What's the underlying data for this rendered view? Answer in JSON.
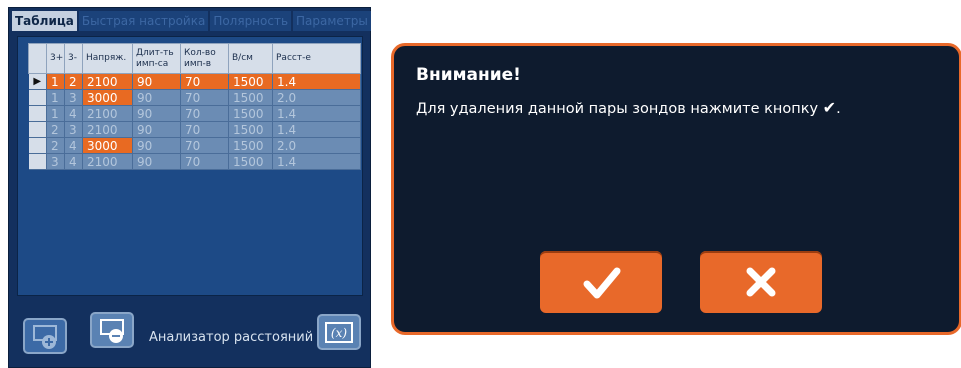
{
  "tabs": [
    {
      "label": "Таблица",
      "active": true
    },
    {
      "label": "Быстрая настройка",
      "active": false
    },
    {
      "label": "Полярность",
      "active": false
    },
    {
      "label": "Параметры",
      "active": false
    }
  ],
  "table": {
    "headers": [
      "",
      "3+",
      "3-",
      "Напряж.",
      "Длит-ть имп-са",
      "Кол-во имп-в",
      "В/см",
      "Расст-е"
    ],
    "rows": [
      {
        "marker": "▶",
        "cells": [
          "1",
          "2",
          "2100",
          "90",
          "70",
          "1500",
          "1.4"
        ],
        "active": true
      },
      {
        "marker": "",
        "cells": [
          "1",
          "3",
          "3000",
          "90",
          "70",
          "1500",
          "2.0"
        ],
        "highlight": 2
      },
      {
        "marker": "",
        "cells": [
          "1",
          "4",
          "2100",
          "90",
          "70",
          "1500",
          "1.4"
        ]
      },
      {
        "marker": "",
        "cells": [
          "2",
          "3",
          "2100",
          "90",
          "70",
          "1500",
          "1.4"
        ]
      },
      {
        "marker": "",
        "cells": [
          "2",
          "4",
          "3000",
          "90",
          "70",
          "1500",
          "2.0"
        ],
        "highlight": 2
      },
      {
        "marker": "",
        "cells": [
          "3",
          "4",
          "2100",
          "90",
          "70",
          "1500",
          "1.4"
        ]
      }
    ]
  },
  "toolbar": {
    "add_icon": "add-pair-icon",
    "remove_icon": "remove-pair-icon",
    "analyzer_label": "Анализатор расстояний",
    "analyzer_icon": "formula-x-icon"
  },
  "dialog": {
    "title": "Внимание!",
    "message": "Для удаления данной пары зондов нажмите кнопку",
    "message_icon": "check-icon",
    "message_end": ".",
    "confirm_icon": "check-icon",
    "cancel_icon": "close-icon"
  },
  "colors": {
    "accent": "#e8692a",
    "panel": "#13305e",
    "dialog_bg": "#0e1b2e"
  }
}
